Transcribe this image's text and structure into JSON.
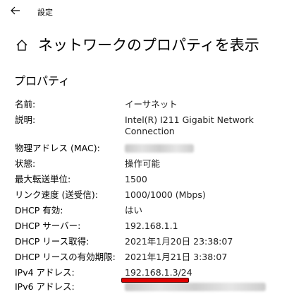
{
  "titlebar": {
    "app_title": "設定"
  },
  "header": {
    "title": "ネットワークのプロパティを表示"
  },
  "section": {
    "title": "プロパティ"
  },
  "properties": [
    {
      "label": "名前:",
      "value": "イーサネット"
    },
    {
      "label": "説明:",
      "value": "Intel(R) I211 Gigabit Network Connection"
    },
    {
      "label": "物理アドレス (MAC):",
      "value": "",
      "redacted": true
    },
    {
      "label": "状態:",
      "value": "操作可能"
    },
    {
      "label": "最大転送単位:",
      "value": "1500"
    },
    {
      "label": "リンク速度 (送受信):",
      "value": "1000/1000 (Mbps)"
    },
    {
      "label": "DHCP 有効:",
      "value": "はい"
    },
    {
      "label": "DHCP サーバー:",
      "value": "192.168.1.1"
    },
    {
      "label": "DHCP リース取得:",
      "value": "2021年1月20日 23:38:07"
    },
    {
      "label": "DHCP リースの有効期限:",
      "value": "2021年1月21日 3:38:07"
    },
    {
      "label": "IPv4 アドレス:",
      "value": "192.168.1.3/24"
    },
    {
      "label": "IPv6 アドレス:",
      "value": "",
      "redacted": true
    }
  ],
  "colors": {
    "highlight": "#e00000"
  }
}
